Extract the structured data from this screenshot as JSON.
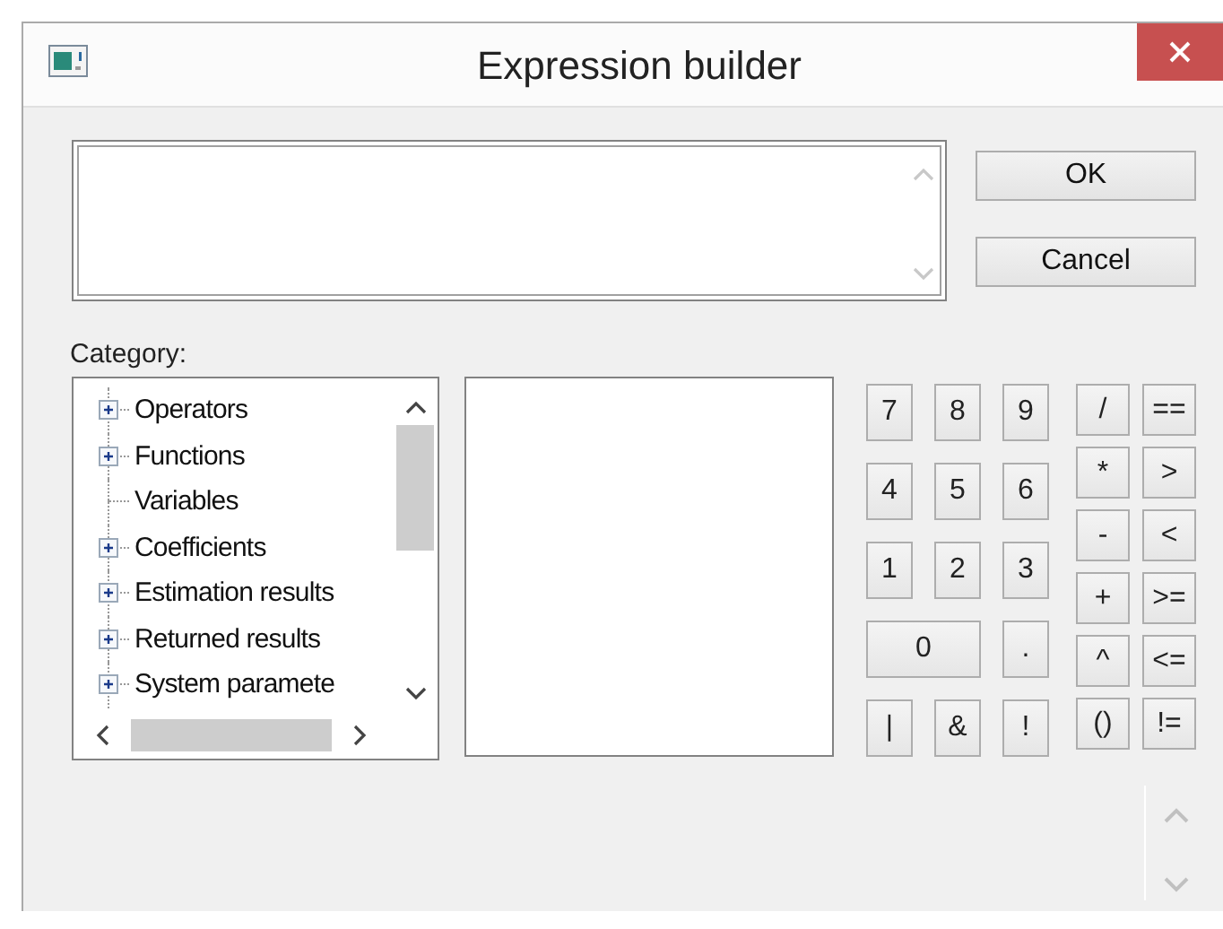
{
  "window": {
    "title": "Expression builder"
  },
  "buttons": [
    "OK",
    "Cancel"
  ],
  "category_label": "Category:",
  "categories": [
    {
      "label": "Operators",
      "expandable": true
    },
    {
      "label": "Functions",
      "expandable": true
    },
    {
      "label": "Variables",
      "expandable": false
    },
    {
      "label": "Coefficients",
      "expandable": true
    },
    {
      "label": "Estimation results",
      "expandable": true
    },
    {
      "label": "Returned results",
      "expandable": true
    },
    {
      "label": "System paramete",
      "expandable": true
    }
  ],
  "digit_keys": [
    {
      "label": "7",
      "kind": "key"
    },
    {
      "label": "8",
      "kind": "key"
    },
    {
      "label": "9",
      "kind": "key"
    },
    {
      "label": "4",
      "kind": "key"
    },
    {
      "label": "5",
      "kind": "key"
    },
    {
      "label": "6",
      "kind": "key"
    },
    {
      "label": "1",
      "kind": "key"
    },
    {
      "label": "2",
      "kind": "key"
    },
    {
      "label": "3",
      "kind": "key"
    },
    {
      "label": "0",
      "kind": "wide"
    },
    {
      "label": ".",
      "kind": "key"
    },
    {
      "label": "|",
      "kind": "key"
    },
    {
      "label": "&",
      "kind": "key"
    },
    {
      "label": "!",
      "kind": "key"
    }
  ],
  "operator_keys": [
    "/",
    "==",
    "*",
    ">",
    "-",
    "<",
    "+",
    ">=",
    "^",
    "<=",
    "()",
    "!="
  ]
}
